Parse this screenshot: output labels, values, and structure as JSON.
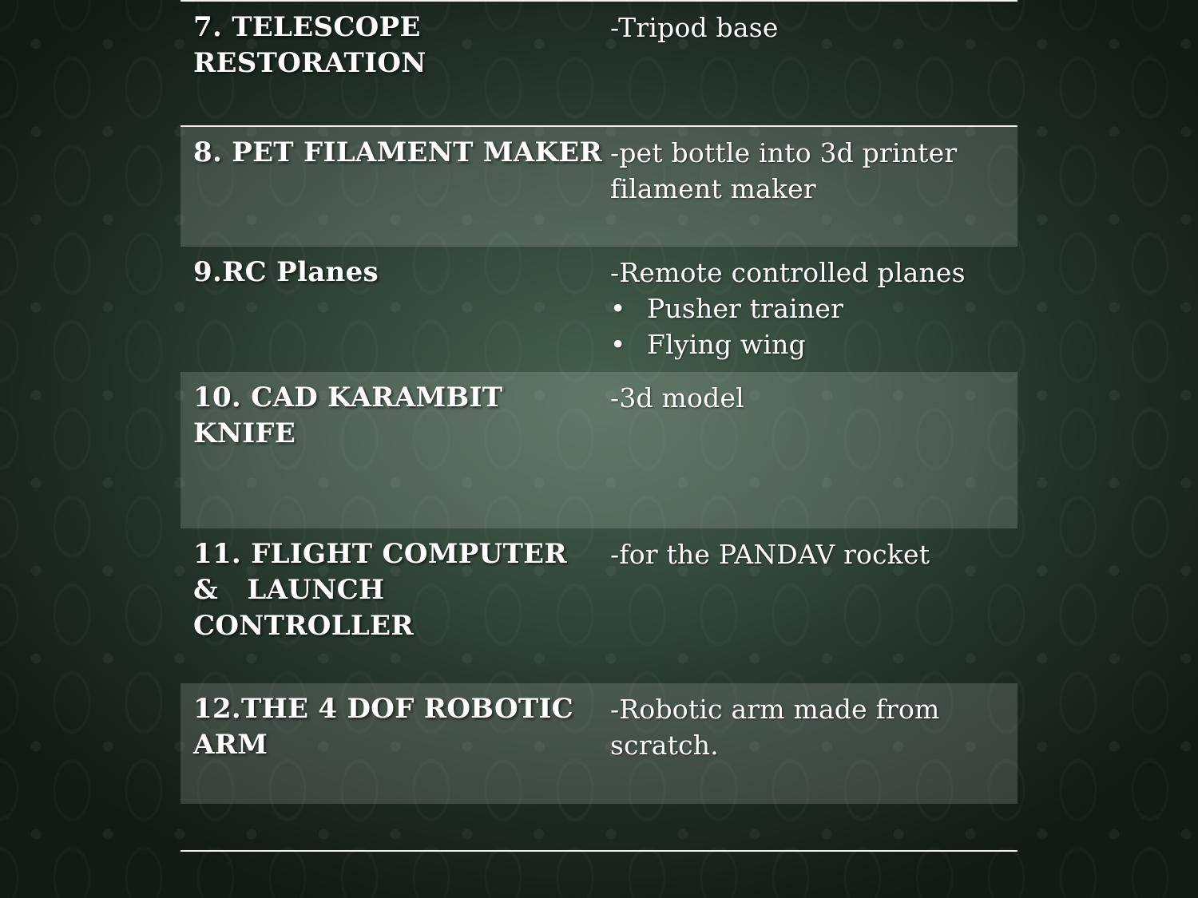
{
  "rows": [
    {
      "title_lines": [
        "7. TELESCOPE",
        "RESTORATION"
      ],
      "desc_lines": [
        "-Tripod base"
      ]
    },
    {
      "title_lines": [
        "8. PET FILAMENT MAKER"
      ],
      "desc_lines": [
        "-pet bottle into 3d printer",
        "filament maker"
      ]
    },
    {
      "title_lines": [
        "9.RC Planes"
      ],
      "desc_lines": [
        "-Remote controlled planes"
      ],
      "bullets": [
        "Pusher trainer",
        "Flying wing"
      ]
    },
    {
      "title_lines": [
        "10. CAD KARAMBIT",
        "KNIFE"
      ],
      "desc_lines": [
        "-3d model"
      ]
    },
    {
      "title_lines": [
        "11. FLIGHT COMPUTER",
        "&   LAUNCH",
        "CONTROLLER"
      ],
      "desc_lines": [
        "-for the PANDAV rocket"
      ]
    },
    {
      "title_lines": [
        "12.THE 4 DOF ROBOTIC",
        "ARM"
      ],
      "desc_lines": [
        "-Robotic arm made from",
        "scratch."
      ]
    }
  ],
  "bullet_glyph": "•",
  "colors": {
    "background": "#2e4437",
    "text": "#ffffff",
    "rule": "#f2f2f2"
  }
}
